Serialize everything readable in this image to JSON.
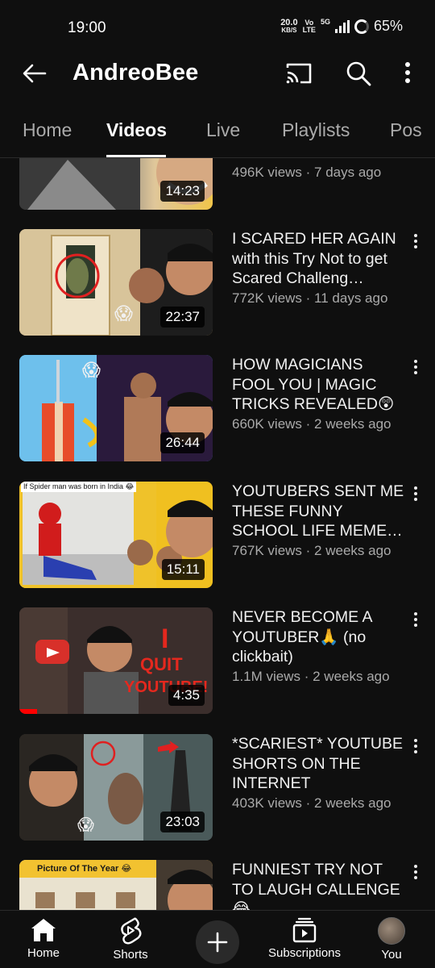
{
  "status_bar": {
    "time": "19:00",
    "net_speed": "20.0",
    "net_unit": "KB/S",
    "volte_top": "Vo",
    "volte_bottom": "LTE",
    "network": "5G",
    "battery": "65%"
  },
  "app_bar": {
    "title": "AndreoBee",
    "back_icon": "arrow-left-icon",
    "cast_icon": "cast-icon",
    "search_icon": "search-icon",
    "more_icon": "more-vert-icon"
  },
  "tabs": [
    {
      "label": "Home",
      "active": false
    },
    {
      "label": "Videos",
      "active": true
    },
    {
      "label": "Live",
      "active": false
    },
    {
      "label": "Playlists",
      "active": false
    },
    {
      "label": "Pos",
      "active": false
    }
  ],
  "videos": [
    {
      "title": "",
      "views": "496K views · 7 days ago",
      "duration": "14:23",
      "palette": [
        "#3a3a3a",
        "#d9c9b0"
      ]
    },
    {
      "title": "I SCARED HER AGAIN with this Try Not to get Scared Challeng…",
      "views": "772K views · 11 days ago",
      "duration": "22:37",
      "palette": [
        "#c8a56a",
        "#1b1b1b"
      ]
    },
    {
      "title": "HOW MAGICIANS FOOL YOU | MAGIC TRICKS REVEALED😲",
      "views": "660K views · 2 weeks ago",
      "duration": "26:44",
      "palette": [
        "#4aa3d8",
        "#2b1a3a"
      ]
    },
    {
      "title": "YOUTUBERS SENT ME THESE FUNNY SCHOOL LIFE MEME…",
      "views": "767K views · 2 weeks ago",
      "duration": "15:11",
      "palette": [
        "#e7e4de",
        "#f0c020"
      ]
    },
    {
      "title": "NEVER BECOME A YOUTUBER🙏 (no clickbait)",
      "views": "1.1M views · 2 weeks ago",
      "duration": "4:35",
      "palette": [
        "#d8302a",
        "#2a2222"
      ]
    },
    {
      "title": "*SCARIEST* YOUTUBE SHORTS ON THE INTERNET",
      "views": "403K views · 2 weeks ago",
      "duration": "23:03",
      "palette": [
        "#6a7a7a",
        "#3a3030"
      ]
    },
    {
      "title": "FUNNIEST TRY NOT TO LAUGH CALLENGE 😂",
      "views": "",
      "duration": "",
      "palette": [
        "#f2c230",
        "#443a30"
      ]
    }
  ],
  "thumb_captions": {
    "spider": "If Spider man was born in India 😂",
    "quit_line1": "I",
    "quit_line2": "QUIT",
    "quit_line3": "YOUTUBE!",
    "picture_year": "Picture Of The Year 😂"
  },
  "bottom_nav": [
    {
      "label": "Home",
      "icon": "home-icon"
    },
    {
      "label": "Shorts",
      "icon": "shorts-icon"
    },
    {
      "label": "",
      "icon": "create-plus-icon"
    },
    {
      "label": "Subscriptions",
      "icon": "subscriptions-icon"
    },
    {
      "label": "You",
      "icon": "avatar"
    }
  ]
}
